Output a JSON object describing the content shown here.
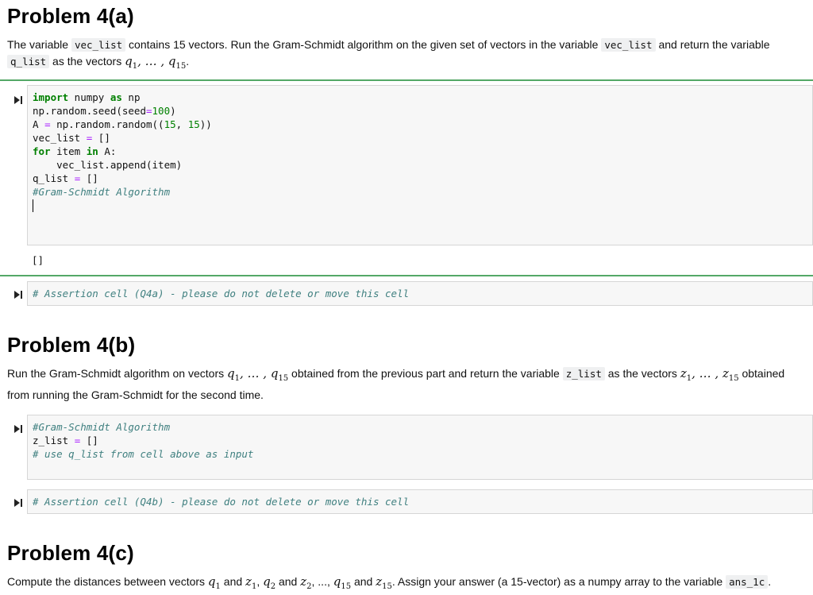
{
  "problem_a": {
    "title": "Problem 4(a)",
    "desc_1": "The variable ",
    "var_vec_list": "vec_list",
    "desc_2": " contains 15 vectors. Run the Gram-Schmidt algorithm on the given set of vectors in the variable ",
    "desc_3": " and return the variable ",
    "var_q_list": "q_list",
    "desc_4": " as the vectors ",
    "desc_5": "."
  },
  "cell_a": {
    "lines": {
      "l1_kw": "import",
      "l1_a": " numpy ",
      "l1_kw2": "as",
      "l1_b": " np",
      "l2_a": "np.random.seed(seed",
      "l2_op": "=",
      "l2_num": "100",
      "l2_b": ")",
      "l3_a": "A ",
      "l3_op": "=",
      "l3_b": " np.random.random((",
      "l3_n1": "15",
      "l3_c": ", ",
      "l3_n2": "15",
      "l3_d": "))",
      "l4_a": "vec_list ",
      "l4_op": "=",
      "l4_b": " []",
      "l5_kw": "for",
      "l5_a": " item ",
      "l5_kw2": "in",
      "l5_b": " A:",
      "l6": "    vec_list.append(item)",
      "l7_a": "q_list ",
      "l7_op": "=",
      "l7_b": " []",
      "l8": "#Gram-Schmidt Algorithm"
    },
    "output": "[]"
  },
  "assert_a": "# Assertion cell (Q4a) - please do not delete or move this cell",
  "problem_b": {
    "title": "Problem 4(b)",
    "desc_1": "Run the Gram-Schmidt algorithm on vectors ",
    "desc_2": " obtained from the previous part and return the variable ",
    "var_z_list": "z_list",
    "desc_3": " as the vectors ",
    "desc_4": " obtained from running the Gram-Schmidt for the second time."
  },
  "cell_b": {
    "l1": "#Gram-Schmidt Algorithm",
    "l2_a": "z_list ",
    "l2_op": "=",
    "l2_b": " []",
    "l3": "# use q_list from cell above as input"
  },
  "assert_b": "# Assertion cell (Q4b) - please do not delete or move this cell",
  "problem_c": {
    "title": "Problem 4(c)",
    "desc_1": "Compute the distances between vectors ",
    "and": " and ",
    "comma": ", ",
    "dots": "...",
    "desc_2": ". Assign your answer (a 15-vector) as a numpy array to the variable ",
    "var_ans": "ans_1c",
    "desc_3": "."
  },
  "math": {
    "q": "q",
    "z": "z",
    "sub1": "1",
    "sub2": "2",
    "sub15": "15",
    "ellipsis": ", … , "
  }
}
